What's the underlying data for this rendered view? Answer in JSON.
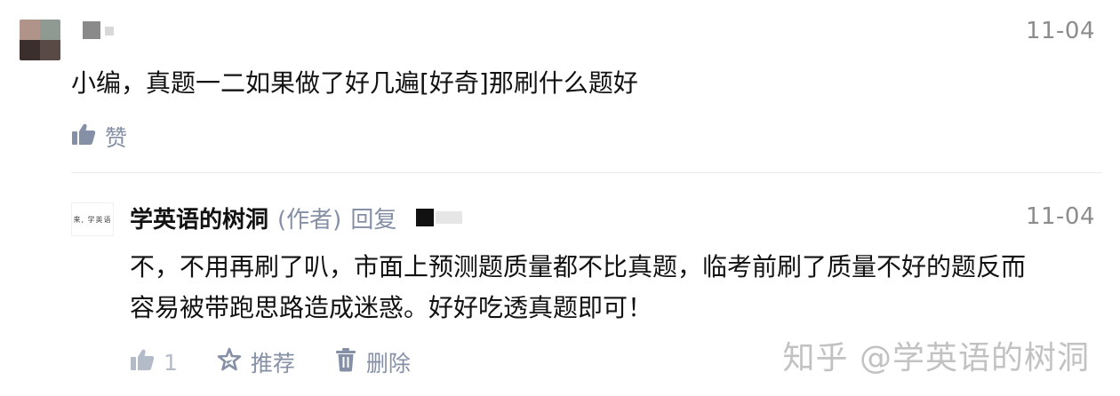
{
  "comment": {
    "date": "11-04",
    "text": "小编，真题一二如果做了好几遍[好奇]那刷什么题好",
    "like_label": "赞"
  },
  "reply": {
    "avatar_text": "来, 学英语",
    "author": "学英语的树洞",
    "author_tag": "(作者)",
    "reply_word": "回复",
    "date": "11-04",
    "text_line1": "不，不用再刷了叭，市面上预测题质量都不比真题，临考前刷了质量不好的题反而",
    "text_line2": "容易被带跑思路造成迷惑。好好吃透真题即可！",
    "like_count": "1",
    "recommend_label": "推荐",
    "delete_label": "删除"
  },
  "watermark": "知乎 @学英语的树洞",
  "colors": {
    "meta_gray": "#8590a6",
    "text": "#121212",
    "divider": "#ebebeb"
  },
  "icons": [
    "thumbs-up-icon",
    "recommend-star-icon",
    "trash-icon"
  ]
}
